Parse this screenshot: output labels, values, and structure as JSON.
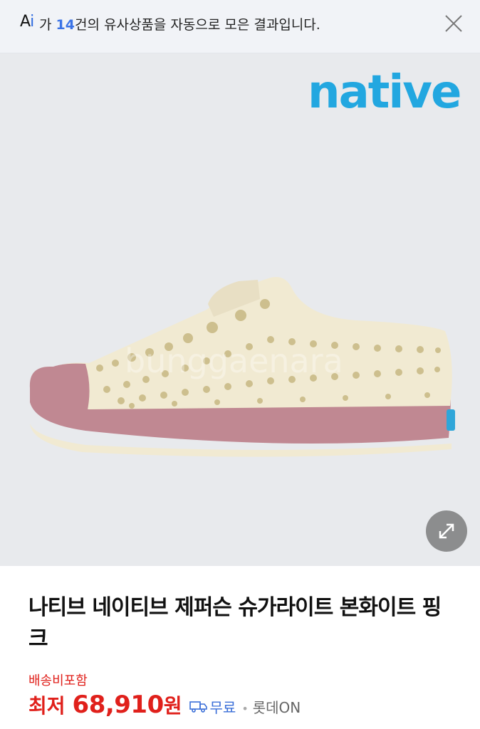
{
  "banner": {
    "logo_prefix": "A",
    "logo_suffix": "i",
    "text_before": "가 ",
    "count": "14",
    "text_after": "건의 유사상품을 자동으로 모은 결과입니다.",
    "close_icon": "close-icon"
  },
  "image": {
    "brand_logo": "native",
    "watermark": "bunggaenara",
    "expand_icon": "expand-icon"
  },
  "product": {
    "title": "나티브 네이티브 제퍼슨 슈가라이트 본화이트 핑크",
    "shipping_note": "배송비포함",
    "price_label": "최저",
    "price": "68,910",
    "currency": "원",
    "delivery_icon": "truck-icon",
    "delivery": "무료",
    "separator": "•",
    "seller": "롯데ON"
  },
  "colors": {
    "accent_red": "#e0201b",
    "accent_blue": "#3b73e6",
    "brand_blue": "#22a7e0"
  }
}
